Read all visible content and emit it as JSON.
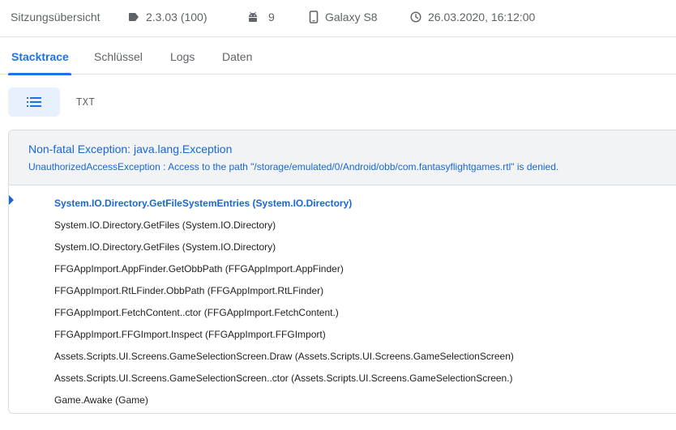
{
  "header": {
    "title": "Sitzungsübersicht",
    "version": "2.3.03 (100)",
    "android_version": "9",
    "device": "Galaxy S8",
    "timestamp": "26.03.2020, 16:12:00"
  },
  "tabs": [
    {
      "label": "Stacktrace",
      "active": true
    },
    {
      "label": "Schlüssel",
      "active": false
    },
    {
      "label": "Logs",
      "active": false
    },
    {
      "label": "Daten",
      "active": false
    }
  ],
  "view_toggle": {
    "list_icon": "list-icon",
    "txt_label": "TXT"
  },
  "exception": {
    "title": "Non-fatal Exception: java.lang.Exception",
    "message": "UnauthorizedAccessException : Access to the path \"/storage/emulated/0/Android/obb/com.fantasyflightgames.rtl\" is denied."
  },
  "frames": [
    "System.IO.Directory.GetFileSystemEntries (System.IO.Directory)",
    "System.IO.Directory.GetFiles (System.IO.Directory)",
    "System.IO.Directory.GetFiles (System.IO.Directory)",
    "FFGAppImport.AppFinder.GetObbPath (FFGAppImport.AppFinder)",
    "FFGAppImport.RtLFinder.ObbPath (FFGAppImport.RtLFinder)",
    "FFGAppImport.FetchContent..ctor (FFGAppImport.FetchContent.)",
    "FFGAppImport.FFGImport.Inspect (FFGAppImport.FFGImport)",
    "Assets.Scripts.UI.Screens.GameSelectionScreen.Draw (Assets.Scripts.UI.Screens.GameSelectionScreen)",
    "Assets.Scripts.UI.Screens.GameSelectionScreen..ctor (Assets.Scripts.UI.Screens.GameSelectionScreen.)",
    "Game.Awake (Game)"
  ],
  "colors": {
    "accent": "#1a73e8",
    "link_text": "#1967d2",
    "header_bg": "#f1f3f4"
  }
}
